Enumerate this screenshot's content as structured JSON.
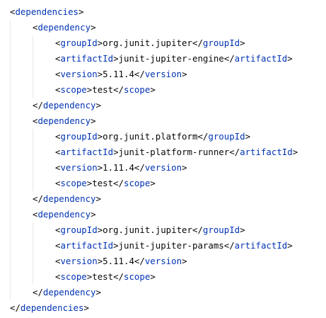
{
  "editor": {
    "language": "xml",
    "colors": {
      "tag": "#0033b3",
      "text": "#080808",
      "background": "#ffffff",
      "indent_guide": "#e8e8e8"
    },
    "lines": [
      {
        "indent": 0,
        "kind": "open",
        "tag": "dependencies"
      },
      {
        "indent": 1,
        "kind": "open",
        "tag": "dependency"
      },
      {
        "indent": 2,
        "kind": "elem",
        "tag": "groupId",
        "text": "org.junit.jupiter"
      },
      {
        "indent": 2,
        "kind": "elem",
        "tag": "artifactId",
        "text": "junit-jupiter-engine"
      },
      {
        "indent": 2,
        "kind": "elem",
        "tag": "version",
        "text": "5.11.4"
      },
      {
        "indent": 2,
        "kind": "elem",
        "tag": "scope",
        "text": "test"
      },
      {
        "indent": 1,
        "kind": "close",
        "tag": "dependency"
      },
      {
        "indent": 1,
        "kind": "open",
        "tag": "dependency"
      },
      {
        "indent": 2,
        "kind": "elem",
        "tag": "groupId",
        "text": "org.junit.platform"
      },
      {
        "indent": 2,
        "kind": "elem",
        "tag": "artifactId",
        "text": "junit-platform-runner"
      },
      {
        "indent": 2,
        "kind": "elem",
        "tag": "version",
        "text": "1.11.4"
      },
      {
        "indent": 2,
        "kind": "elem",
        "tag": "scope",
        "text": "test"
      },
      {
        "indent": 1,
        "kind": "close",
        "tag": "dependency"
      },
      {
        "indent": 1,
        "kind": "open",
        "tag": "dependency"
      },
      {
        "indent": 2,
        "kind": "elem",
        "tag": "groupId",
        "text": "org.junit.jupiter"
      },
      {
        "indent": 2,
        "kind": "elem",
        "tag": "artifactId",
        "text": "junit-jupiter-params"
      },
      {
        "indent": 2,
        "kind": "elem",
        "tag": "version",
        "text": "5.11.4"
      },
      {
        "indent": 2,
        "kind": "elem",
        "tag": "scope",
        "text": "test"
      },
      {
        "indent": 1,
        "kind": "close",
        "tag": "dependency"
      },
      {
        "indent": 0,
        "kind": "close",
        "tag": "dependencies"
      }
    ]
  }
}
